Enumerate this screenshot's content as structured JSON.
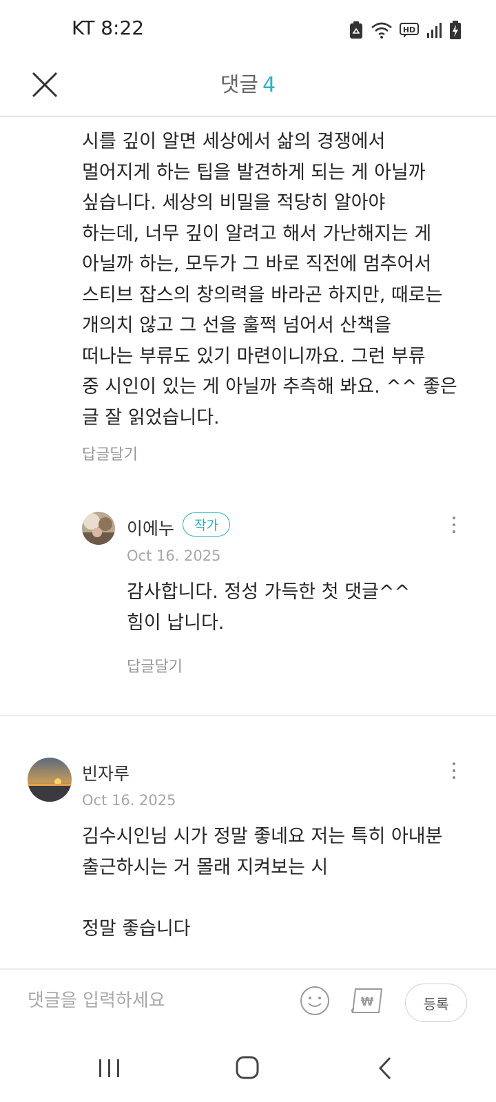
{
  "status_bar": {
    "time": "KT 8:22",
    "icons": [
      "recycle-notification-icon",
      "wifi-icon",
      "hd-voice-icon",
      "signal-icon",
      "battery-charging-icon"
    ]
  },
  "header": {
    "title": "댓글",
    "count": "4",
    "accent_color": "#2bb3c0"
  },
  "comments": [
    {
      "lines": [
        "시를 깊이 알면 세상에서 삶의 경쟁에서",
        "멀어지게 하는 팁을 발견하게 되는 게 아닐까",
        "싶습니다. 세상의 비밀을 적당히 알아야",
        "하는데, 너무 깊이 알려고 해서 가난해지는 게",
        "아닐까 하는, 모두가 그 바로 직전에 멈추어서",
        "스티브 잡스의 창의력을 바라곤 하지만, 때로는",
        "개의치 않고 그 선을 훌쩍 넘어서 산책을",
        "떠나는 부류도 있기 마련이니까요. 그런 부류",
        "중 시인이 있는 게 아닐까 추측해 봐요. ^^ 좋은",
        "글 잘 읽었습니다."
      ],
      "reply_label": "답글달기"
    },
    {
      "author": "이에누",
      "badge": "작가",
      "date": "Oct 16. 2025",
      "lines": [
        "감사합니다.  정성 가득한 첫 댓글^^",
        "힘이 납니다."
      ],
      "reply_label": "답글달기"
    },
    {
      "author": "빈자루",
      "date": "Oct 16. 2025",
      "lines": [
        "김수시인님 시가 정말 좋네요 저는 특히 아내분",
        "출근하시는 거 몰래 지켜보는 시",
        "",
        "정말 좋습니다"
      ]
    }
  ],
  "input_bar": {
    "placeholder": "댓글을 입력하세요",
    "submit_label": "등록"
  },
  "nav_bar": {
    "buttons": [
      "recent-apps",
      "home",
      "back"
    ]
  }
}
